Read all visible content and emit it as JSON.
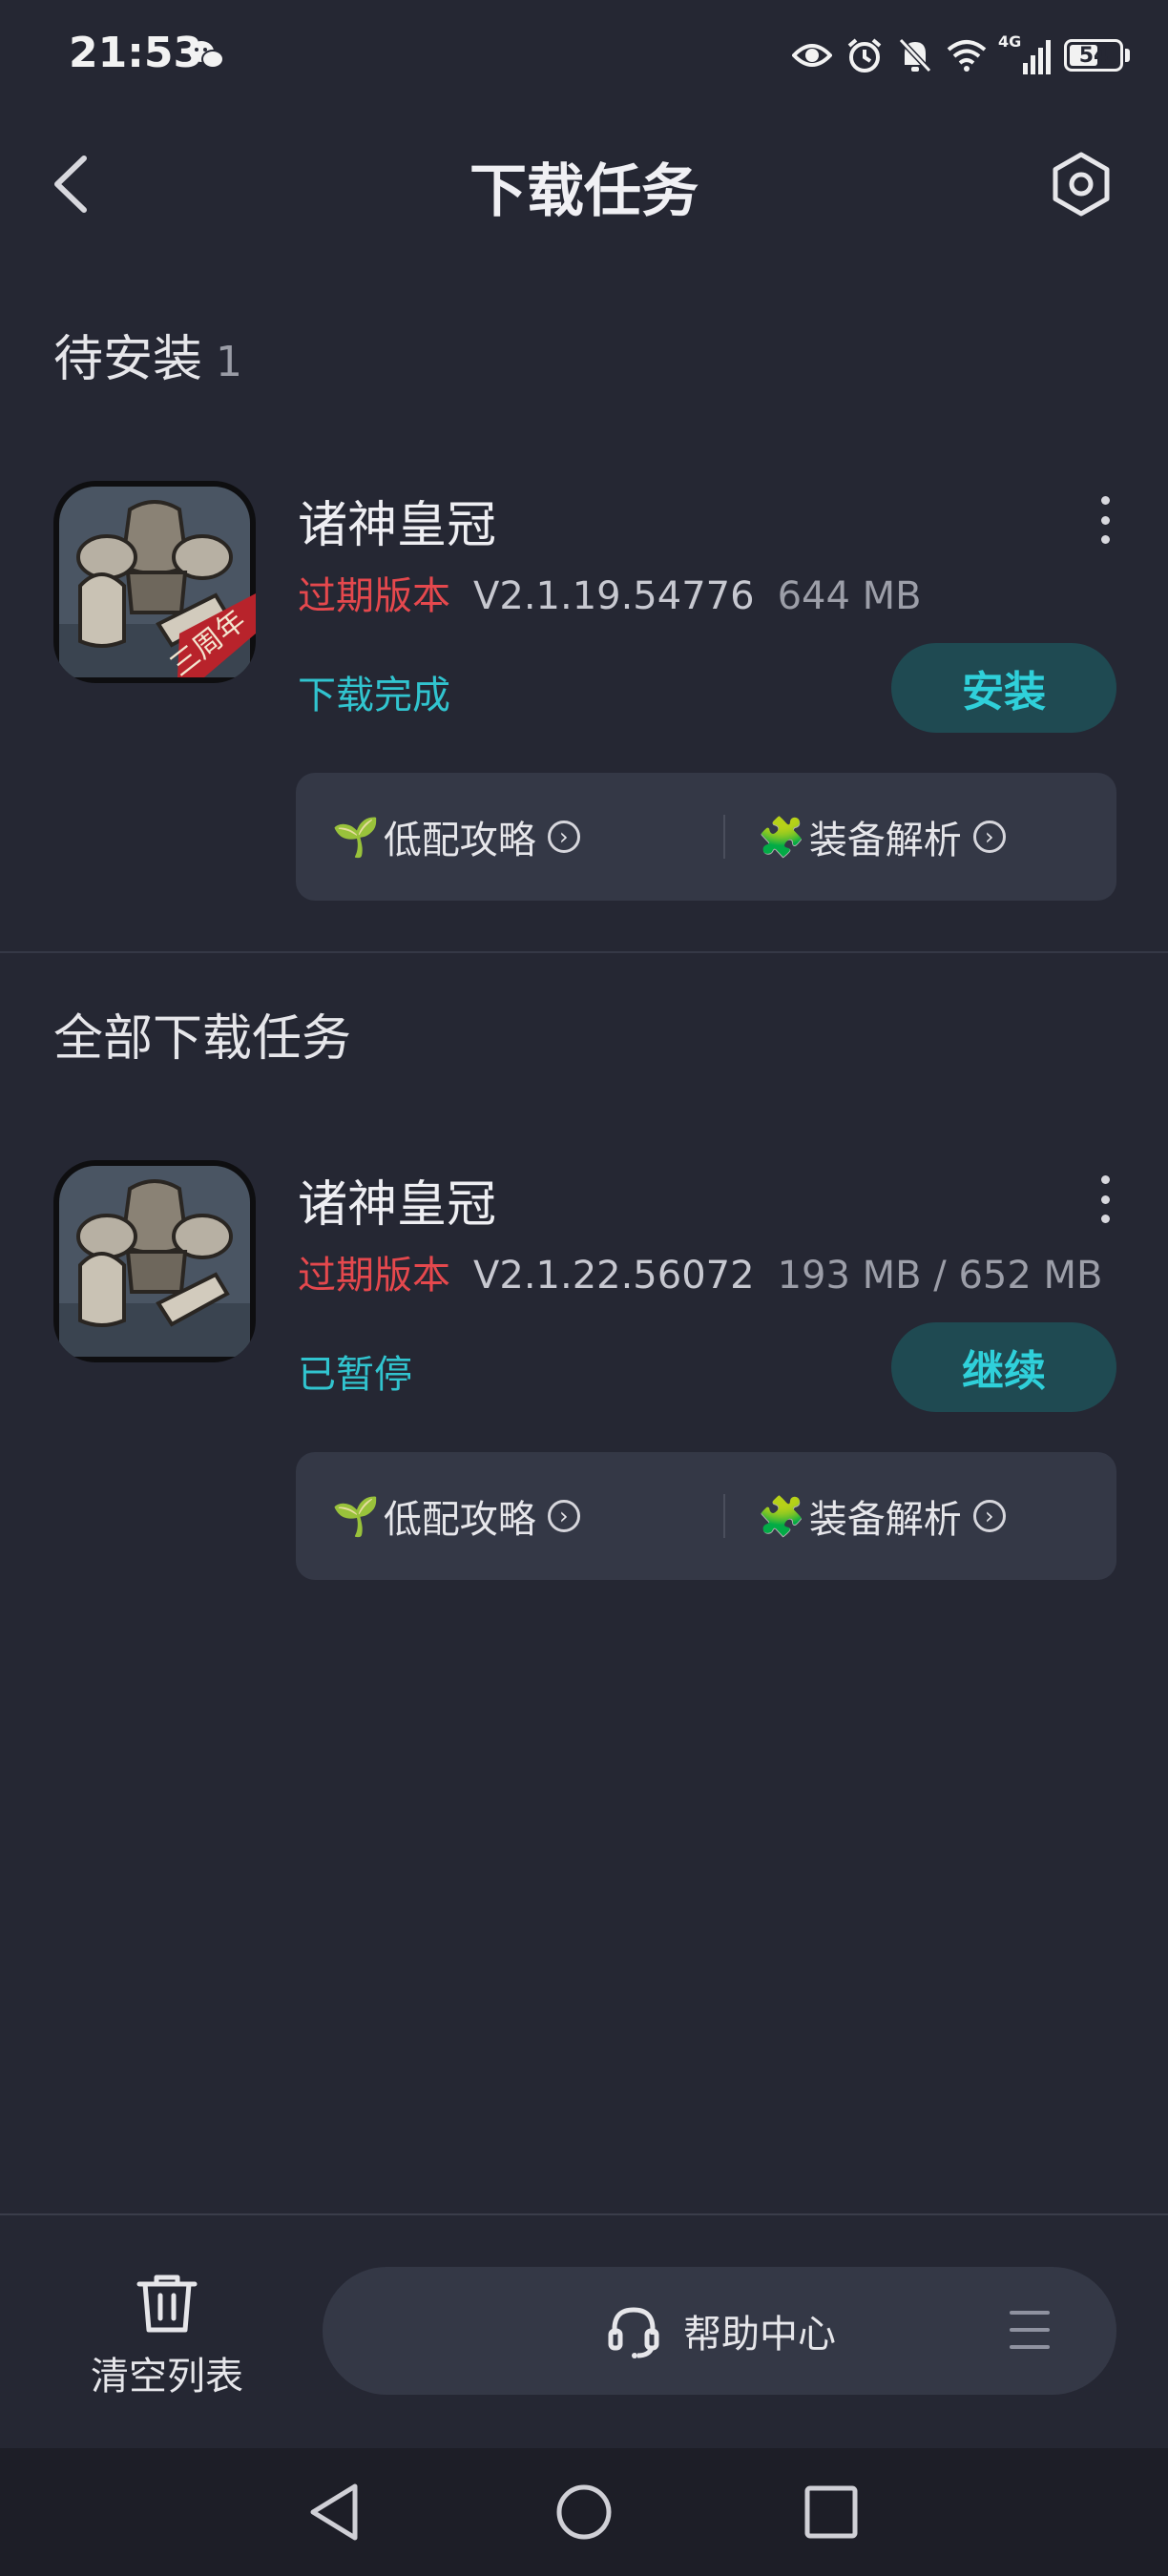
{
  "status_bar": {
    "time": "21:53",
    "icons": [
      "wechat-icon",
      "eye-icon",
      "alarm-icon",
      "mute-icon",
      "wifi-icon",
      "signal-4g-icon",
      "battery-icon"
    ],
    "network_label": "4G",
    "battery": 54
  },
  "header": {
    "title": "下载任务",
    "back_icon": "chevron-left-icon",
    "settings_icon": "hexagon-settings-icon"
  },
  "pending_section": {
    "title": "待安装",
    "count": "1",
    "item": {
      "name": "诸神皇冠",
      "status_tag": "过期版本",
      "version": "V2.1.19.54776",
      "size": "644 MB",
      "state": "下载完成",
      "action": "安装",
      "icon_banner": "三周年",
      "guides": [
        {
          "icon": "🌱",
          "label": "低配攻略"
        },
        {
          "icon": "🧩",
          "label": "装备解析"
        }
      ]
    }
  },
  "all_section": {
    "title": "全部下载任务",
    "item": {
      "name": "诸神皇冠",
      "status_tag": "过期版本",
      "version": "V2.1.22.56072",
      "size": "193 MB / 652 MB",
      "state": "已暂停",
      "action": "继续",
      "guides": [
        {
          "icon": "🌱",
          "label": "低配攻略"
        },
        {
          "icon": "🧩",
          "label": "装备解析"
        }
      ]
    }
  },
  "bottom_bar": {
    "clear_label": "清空列表",
    "help_label": "帮助中心"
  },
  "colors": {
    "background": "#252733",
    "accent": "#2fd0da",
    "expired": "#e5484d"
  }
}
